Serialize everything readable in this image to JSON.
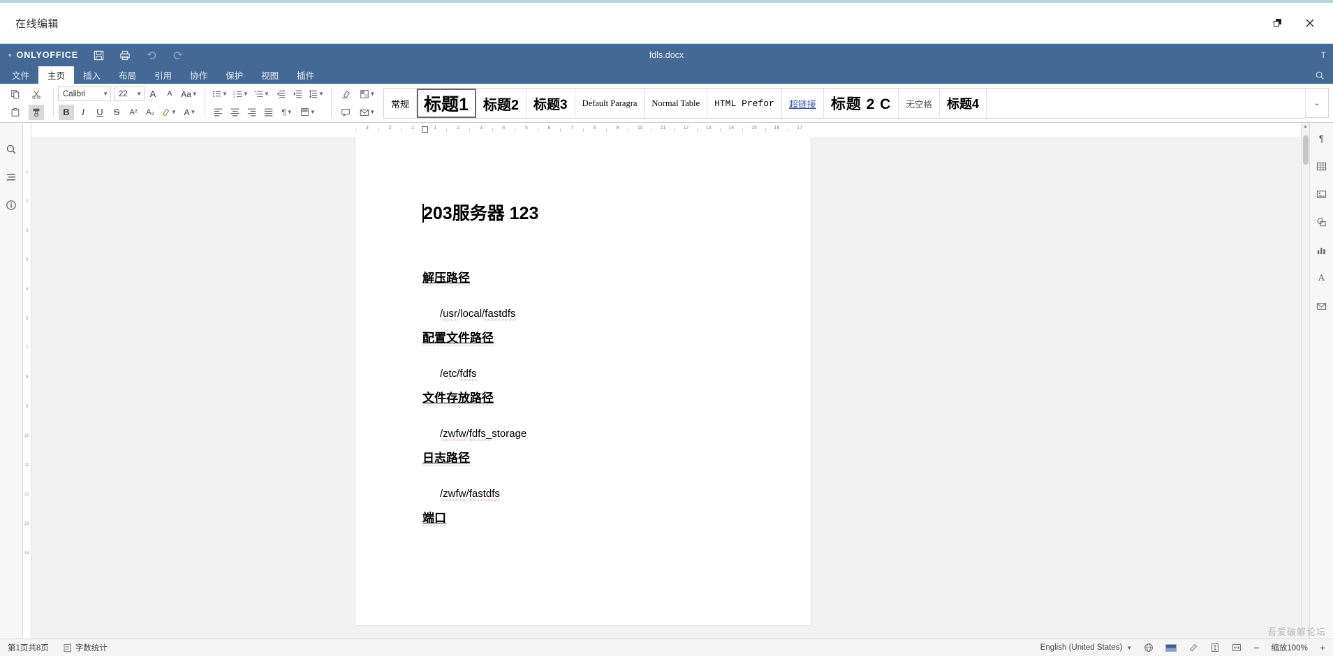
{
  "window": {
    "title": "在线编辑",
    "restore_label": "❐",
    "close_label": "✕"
  },
  "app": {
    "brand": "ONLYOFFICE",
    "document_name": "fdls.docx",
    "header_icons": [
      "save-icon",
      "print-icon",
      "undo-icon",
      "redo-icon"
    ],
    "search_icon": "search-icon",
    "avatar": "T"
  },
  "tabs": [
    {
      "label": "文件",
      "active": false
    },
    {
      "label": "主页",
      "active": true
    },
    {
      "label": "插入",
      "active": false
    },
    {
      "label": "布局",
      "active": false
    },
    {
      "label": "引用",
      "active": false
    },
    {
      "label": "协作",
      "active": false
    },
    {
      "label": "保护",
      "active": false
    },
    {
      "label": "视图",
      "active": false
    },
    {
      "label": "插件",
      "active": false
    }
  ],
  "toolbar": {
    "font_name": "Calibri",
    "font_size": "22",
    "increase_font": "A",
    "decrease_font": "A",
    "change_case": "Aa",
    "bold": "B",
    "italic": "I",
    "underline": "U",
    "strikethrough": "S",
    "superscript": "A²",
    "subscript": "A₂",
    "highlight_color": "A",
    "font_color": "A",
    "copy_label": "copy-icon",
    "cut_label": "cut-icon",
    "paste_label": "paste-icon",
    "format_painter_label": "format-painter-icon",
    "bullets": "bullet-list-icon",
    "numbering": "numbered-list-icon",
    "multilevel": "multilevel-list-icon",
    "decrease_indent": "decrease-indent-icon",
    "increase_indent": "increase-indent-icon",
    "line_spacing": "line-spacing-icon",
    "align_left": "align-left-icon",
    "align_center": "align-center-icon",
    "align_right": "align-right-icon",
    "align_justify": "align-justify-icon",
    "paragraph_marks": "paragraph-marks-icon",
    "clear_style": "clear-style-icon",
    "shading": "shading-icon",
    "borders": "borders-icon",
    "insert_link": "insert-link-icon"
  },
  "style_gallery": {
    "items": [
      {
        "label": "常规",
        "class": "s-normal",
        "selected": false
      },
      {
        "label": "标题1",
        "class": "s-h1",
        "selected": true
      },
      {
        "label": "标题2",
        "class": "s-h2",
        "selected": false
      },
      {
        "label": "标题3",
        "class": "s-h3",
        "selected": false
      },
      {
        "label": "Default Paragra",
        "class": "s-serif",
        "selected": false
      },
      {
        "label": "Normal Table",
        "class": "s-serif",
        "selected": false
      },
      {
        "label": "HTML Prefor",
        "class": "s-mono",
        "selected": false
      },
      {
        "label": "超链接",
        "class": "s-link",
        "selected": false
      },
      {
        "label": "标题 2 C",
        "class": "s-h2c",
        "selected": false
      },
      {
        "label": "无空格",
        "class": "s-nospace",
        "selected": false
      },
      {
        "label": "标题4",
        "class": "s-h4",
        "selected": false
      }
    ],
    "expand_label": "⌄"
  },
  "left_rail": {
    "items": [
      "search-icon",
      "headings-icon",
      "about-icon"
    ]
  },
  "right_rail": {
    "items": [
      "paragraph-settings-icon",
      "table-settings-icon",
      "image-settings-icon",
      "shape-settings-icon",
      "chart-settings-icon",
      "text-art-settings-icon",
      "mail-merge-icon"
    ]
  },
  "ruler": {
    "horizontal_ticks": [
      "3",
      "2",
      "1",
      "1",
      "2",
      "3",
      "4",
      "5",
      "6",
      "7",
      "8",
      "9",
      "10",
      "11",
      "12",
      "13",
      "14",
      "15",
      "16",
      "17"
    ],
    "vertical_ticks": [
      "1",
      "2",
      "3",
      "4",
      "5",
      "6",
      "7",
      "8",
      "9",
      "10",
      "11",
      "12",
      "13",
      "14"
    ]
  },
  "document": {
    "title": "203服务器  123",
    "blocks": [
      {
        "type": "heading",
        "text": "解压路径"
      },
      {
        "type": "para",
        "parts": [
          {
            "t": "/",
            "sp": false
          },
          {
            "t": "usr",
            "sp": true
          },
          {
            "t": "/local/",
            "sp": false
          },
          {
            "t": "fastdfs",
            "sp": true
          }
        ]
      },
      {
        "type": "heading",
        "text": "配置文件路径"
      },
      {
        "type": "para",
        "parts": [
          {
            "t": "/etc/",
            "sp": false
          },
          {
            "t": "fdfs",
            "sp": true
          }
        ]
      },
      {
        "type": "heading",
        "text": "文件存放路径"
      },
      {
        "type": "para",
        "parts": [
          {
            "t": "/",
            "sp": false
          },
          {
            "t": "zwfw",
            "sp": true
          },
          {
            "t": "/",
            "sp": false
          },
          {
            "t": "fdfs_",
            "sp": true
          },
          {
            "t": "storage",
            "sp": false
          }
        ]
      },
      {
        "type": "heading",
        "text": "日志路径"
      },
      {
        "type": "para",
        "parts": [
          {
            "t": "/",
            "sp": false
          },
          {
            "t": "zwfw",
            "sp": true
          },
          {
            "t": "/",
            "sp": false
          },
          {
            "t": "fastdfs",
            "sp": true
          }
        ]
      },
      {
        "type": "heading",
        "text": "端口"
      }
    ]
  },
  "statusbar": {
    "page_info": "第1页共8页",
    "word_count": "字数统计",
    "language": "English (United States)",
    "spellcheck_icon": "spellcheck-icon",
    "track_changes_icon": "track-changes-icon",
    "fit_page_icon": "fit-page-icon",
    "fit_width_icon": "fit-width-icon",
    "zoom_out": "−",
    "zoom_level": "缩放100%",
    "zoom_in": "+"
  },
  "watermark": "吾爱破解论坛"
}
